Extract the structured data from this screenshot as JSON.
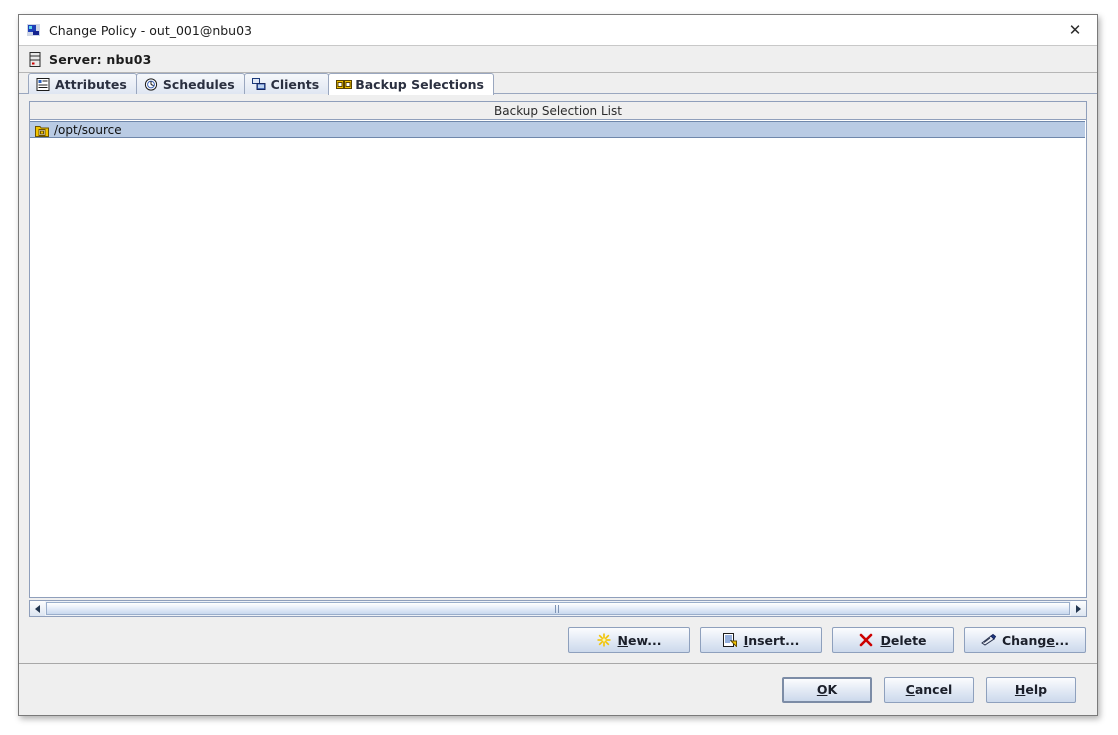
{
  "window": {
    "title": "Change Policy - out_001@nbu03",
    "title_icon": "app-icon",
    "close_label": "✕"
  },
  "server": {
    "icon": "server-icon",
    "label": "Server: nbu03"
  },
  "tabs": [
    {
      "label": "Attributes",
      "icon": "attributes-icon",
      "active": false
    },
    {
      "label": "Schedules",
      "icon": "clock-icon",
      "active": false
    },
    {
      "label": "Clients",
      "icon": "clients-icon",
      "active": false
    },
    {
      "label": "Backup Selections",
      "icon": "backup-selections-icon",
      "active": true
    }
  ],
  "list": {
    "header": "Backup Selection List",
    "rows": [
      {
        "label": "/opt/source",
        "icon": "folder-file-icon",
        "selected": true
      }
    ]
  },
  "scrollbar": {
    "left_arrow": "scroll-left-arrow",
    "right_arrow": "scroll-right-arrow"
  },
  "actions": [
    {
      "key": "new",
      "pre": "",
      "mn": "N",
      "post": "ew...",
      "icon": "starburst-icon"
    },
    {
      "key": "insert",
      "pre": "",
      "mn": "I",
      "post": "nsert...",
      "icon": "insert-doc-icon"
    },
    {
      "key": "delete",
      "pre": "",
      "mn": "D",
      "post": "elete",
      "icon": "red-x-icon"
    },
    {
      "key": "change",
      "pre": "Chang",
      "mn": "e",
      "post": "...",
      "icon": "pencil-icon"
    }
  ],
  "footer": [
    {
      "key": "ok",
      "pre": "",
      "mn": "O",
      "post": "K",
      "focused": true
    },
    {
      "key": "cancel",
      "pre": "",
      "mn": "C",
      "post": "ancel",
      "focused": false
    },
    {
      "key": "help",
      "pre": "",
      "mn": "H",
      "post": "elp",
      "focused": false
    }
  ],
  "colors": {
    "selection": "#b9cbe4",
    "tab_border": "#9aa7bf",
    "accent_yellow": "#f2c400",
    "delete_red": "#cc0000"
  }
}
